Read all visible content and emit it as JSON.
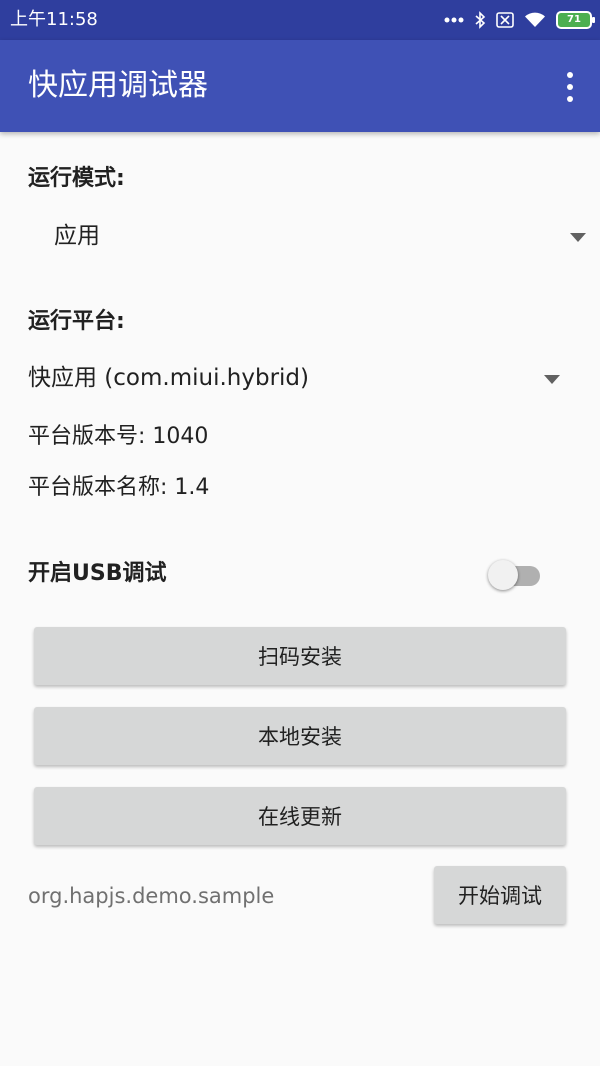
{
  "status_bar": {
    "time": "上午11:58",
    "icons": [
      "more-dots-icon",
      "bluetooth-icon",
      "no-sim-icon",
      "wifi-icon",
      "battery-icon"
    ],
    "battery_level": "71",
    "battery_color": "#4caf50"
  },
  "app_bar": {
    "title": "快应用调试器",
    "menu_icon": "more-vert-icon",
    "color": "#3f51b5"
  },
  "run_mode": {
    "label": "运行模式:",
    "selected": "应用"
  },
  "platform": {
    "label": "运行平台:",
    "selected": "快应用 (com.miui.hybrid)",
    "version_code": "平台版本号: 1040",
    "version_name": "平台版本名称: 1.4"
  },
  "usb_debug": {
    "label": "开启USB调试",
    "enabled": false
  },
  "buttons": {
    "scan_install": "扫码安装",
    "local_install": "本地安装",
    "online_update": "在线更新",
    "start_debug": "开始调试"
  },
  "package_name": "org.hapjs.demo.sample"
}
